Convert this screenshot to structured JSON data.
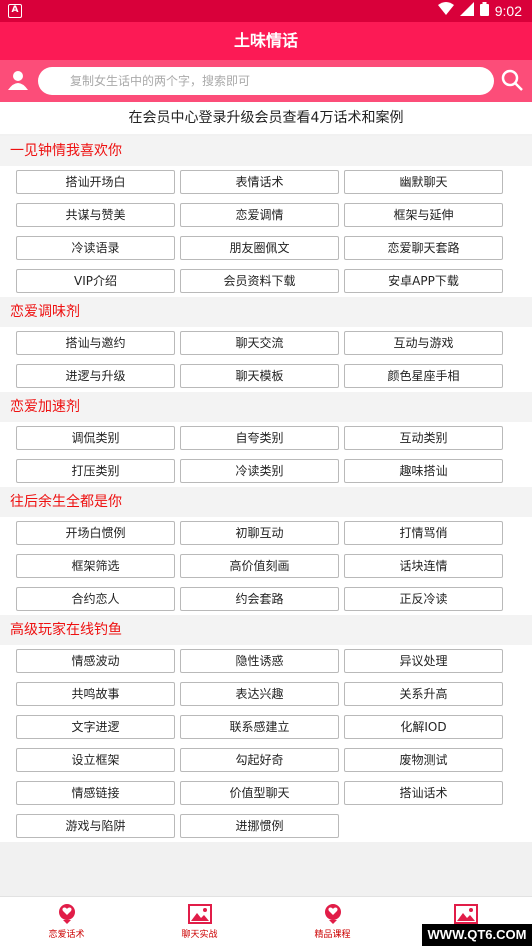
{
  "status": {
    "time": "9:02"
  },
  "app": {
    "title": "土味情话"
  },
  "search": {
    "placeholder": "复制女生话中的两个字，搜索即可"
  },
  "banner": {
    "text": "在会员中心登录升级会员查看4万话术和案例"
  },
  "sections": [
    {
      "title": "一见钟情我喜欢你",
      "items": [
        "搭讪开场白",
        "表情话术",
        "幽默聊天",
        "共谋与赞美",
        "恋爱调情",
        "框架与延伸",
        "冷读语录",
        "朋友圈佩文",
        "恋爱聊天套路",
        "VIP介绍",
        "会员资料下载",
        "安卓APP下载"
      ]
    },
    {
      "title": "恋爱调味剂",
      "items": [
        "搭讪与邀约",
        "聊天交流",
        "互动与游戏",
        "进逻与升级",
        "聊天模板",
        "颜色星座手相"
      ]
    },
    {
      "title": "恋爱加速剂",
      "items": [
        "调侃类别",
        "自夸类别",
        "互动类别",
        "打压类别",
        "冷读类别",
        "趣味搭讪"
      ]
    },
    {
      "title": "往后余生全都是你",
      "items": [
        "开场白惯例",
        "初聊互动",
        "打情骂俏",
        "框架筛选",
        "高价值刻画",
        "话块连情",
        "合约恋人",
        "约会套路",
        "正反冷读"
      ]
    },
    {
      "title": "高级玩家在线钓鱼",
      "items": [
        "情感波动",
        "隐性诱惑",
        "异议处理",
        "共鸣故事",
        "表达兴趣",
        "关系升高",
        "文字进逻",
        "联系感建立",
        "化解IOD",
        "设立框架",
        "勾起好奇",
        "废物测试",
        "情感链接",
        "价值型聊天",
        "搭讪话术",
        "游戏与陷阱",
        "进挪惯例"
      ]
    }
  ],
  "tabs": [
    {
      "label": "恋爱话术",
      "icon": "heart-badge-icon"
    },
    {
      "label": "聊天实战",
      "icon": "image-icon"
    },
    {
      "label": "精品课程",
      "icon": "heart-badge-icon"
    },
    {
      "label": "",
      "icon": "image-icon"
    }
  ],
  "watermark": {
    "text": "WWW.QT6.COM"
  },
  "colors": {
    "primary": "#fc1a55",
    "statusbar": "#d9003a",
    "search_bg": "#fc4d79",
    "section_title": "#e11111"
  }
}
